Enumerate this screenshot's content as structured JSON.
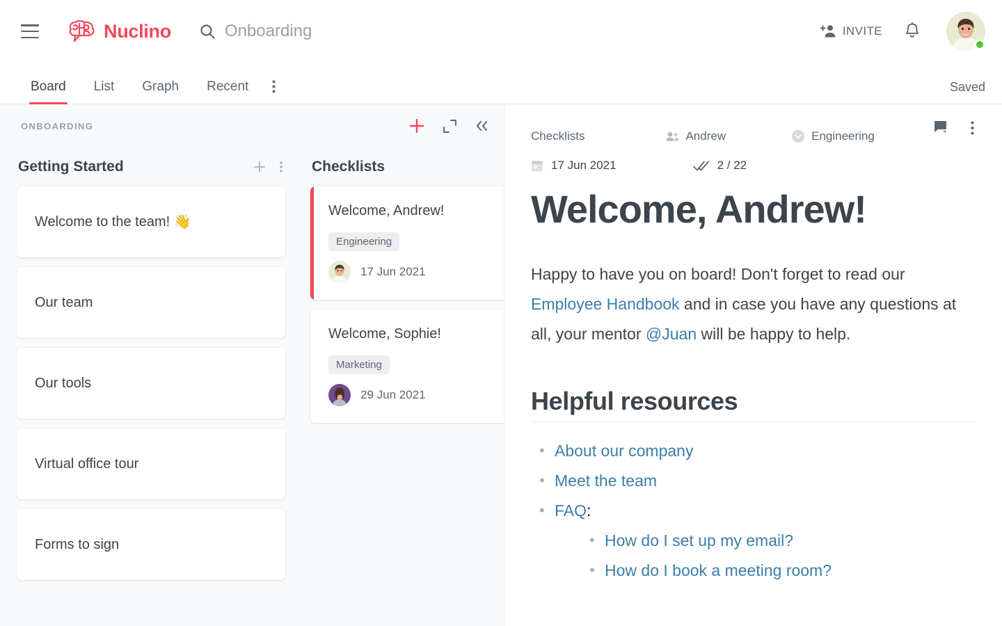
{
  "header": {
    "brand": "Nuclino",
    "search_value": "Onboarding",
    "invite_label": "INVITE",
    "icons": {
      "menu": "hamburger-icon",
      "search": "search-icon",
      "invite": "person-add-icon",
      "bell": "bell-icon",
      "avatar": "user-avatar"
    },
    "status": "online"
  },
  "tabbar": {
    "tabs": [
      {
        "label": "Board",
        "active": true
      },
      {
        "label": "List",
        "active": false
      },
      {
        "label": "Graph",
        "active": false
      },
      {
        "label": "Recent",
        "active": false
      }
    ],
    "more_icon": "more-vertical-icon",
    "save_status": "Saved"
  },
  "board": {
    "title": "ONBOARDING",
    "actions": {
      "add": "plus-icon",
      "expand": "expand-icon",
      "collapse": "chevron-double-left-icon"
    },
    "columns": [
      {
        "name": "Getting Started",
        "add_icon": "plus-icon",
        "more_icon": "more-vertical-icon",
        "cards": [
          {
            "title": "Welcome to the team! 👋"
          },
          {
            "title": "Our team"
          },
          {
            "title": "Our tools"
          },
          {
            "title": "Virtual office tour"
          },
          {
            "title": "Forms to sign"
          }
        ]
      },
      {
        "name": "Checklists",
        "cards": [
          {
            "title": "Welcome, Andrew!",
            "tag": "Engineering",
            "date": "17 Jun 2021",
            "selected": true,
            "avatar": "andrew-avatar"
          },
          {
            "title": "Welcome, Sophie!",
            "tag": "Marketing",
            "date": "29 Jun 2021",
            "selected": false,
            "avatar": "sophie-avatar"
          }
        ]
      }
    ]
  },
  "doc": {
    "breadcrumb": {
      "collection": "Checklists",
      "assignee": "Andrew",
      "assignee_icon": "people-icon",
      "team": "Engineering",
      "team_icon": "chevron-down-circle-icon"
    },
    "meta": {
      "date_icon": "calendar-icon",
      "date": "17 Jun 2021",
      "tasks_icon": "double-check-icon",
      "tasks": "2 / 22"
    },
    "head_actions": {
      "comments": "comment-icon",
      "more": "more-vertical-icon"
    },
    "title": "Welcome, Andrew!",
    "paragraph": {
      "part1": "Happy to have you on board! Don't forget to read our ",
      "link1": "Employee Handbook",
      "part2": " and in case you have any questions at all, your mentor ",
      "link2": "@Juan",
      "part3": " will be happy to help."
    },
    "section_heading": "Helpful resources",
    "resources": [
      "About our company",
      "Meet the team"
    ],
    "faq_label": "FAQ",
    "faq_suffix": ":",
    "faq_items": [
      "How do I set up my email?",
      "How do I book a meeting room?"
    ]
  },
  "colors": {
    "accent": "#F4475B",
    "link": "#3B7EA8",
    "text": "#3C444C",
    "muted": "#5C6670",
    "board_bg": "#F8F9FA",
    "online": "#4CC832"
  }
}
